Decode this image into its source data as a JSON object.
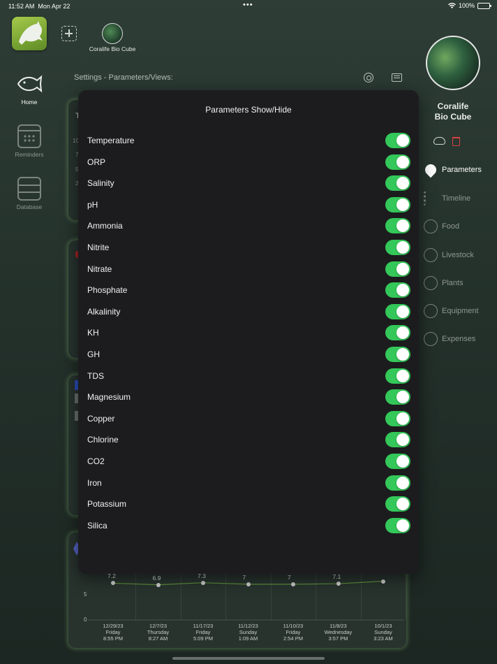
{
  "status_bar": {
    "time": "11:52 AM",
    "date": "Mon Apr 22",
    "dots": "•••",
    "battery": "100%"
  },
  "top_bar": {
    "tank_label": "Coralife Bio Cube"
  },
  "left_nav": {
    "home": "Home",
    "reminders": "Reminders",
    "database": "Database"
  },
  "header": {
    "settings_title": "Settings - Parameters/Views:"
  },
  "right_panel": {
    "tank_name": "Coralife\nBio Cube",
    "nav": [
      {
        "label": "Parameters",
        "icon": "drop-icon"
      },
      {
        "label": "Timeline",
        "icon": "list-icon"
      },
      {
        "label": "Food",
        "icon": "fork-knife-icon"
      },
      {
        "label": "Livestock",
        "icon": "fish-icon"
      },
      {
        "label": "Plants",
        "icon": "plant-icon"
      },
      {
        "label": "Equipment",
        "icon": "gear-icon"
      },
      {
        "label": "Expenses",
        "icon": "card-icon"
      }
    ]
  },
  "background_cards": {
    "snippets": [
      "T",
      "10",
      "7",
      "5",
      "2"
    ]
  },
  "chart_data": {
    "type": "line",
    "categories": [
      "12/29/23",
      "12/7/23",
      "11/17/23",
      "11/12/23",
      "11/10/23",
      "11/8/23",
      "10/1/23"
    ],
    "day_labels": [
      "Friday",
      "Thursday",
      "Friday",
      "Sunday",
      "Friday",
      "Wednesday",
      "Sunday"
    ],
    "time_labels": [
      "8:55 PM",
      "8:27 AM",
      "5:09 PM",
      "1:09 AM",
      "2:54 PM",
      "3:57 PM",
      "3:23 AM"
    ],
    "values": [
      7.2,
      6.9,
      7.3,
      7,
      7,
      7.1,
      7.6
    ],
    "value_labels": [
      "7.2",
      "6.9",
      "7.3",
      "7",
      "7",
      "7.1",
      ""
    ],
    "y_ticks": [
      "5",
      "0"
    ],
    "ylim": [
      0,
      8.5
    ],
    "line_color": "#5d8f3a"
  },
  "modal": {
    "title": "Parameters Show/Hide",
    "parameters": [
      {
        "label": "Temperature",
        "enabled": true
      },
      {
        "label": "ORP",
        "enabled": true
      },
      {
        "label": "Salinity",
        "enabled": true
      },
      {
        "label": "pH",
        "enabled": true
      },
      {
        "label": "Ammonia",
        "enabled": true
      },
      {
        "label": "Nitrite",
        "enabled": true
      },
      {
        "label": "Nitrate",
        "enabled": true
      },
      {
        "label": "Phosphate",
        "enabled": true
      },
      {
        "label": "Alkalinity",
        "enabled": true
      },
      {
        "label": "KH",
        "enabled": true
      },
      {
        "label": "GH",
        "enabled": true
      },
      {
        "label": "TDS",
        "enabled": true
      },
      {
        "label": "Magnesium",
        "enabled": true
      },
      {
        "label": "Copper",
        "enabled": true
      },
      {
        "label": "Chlorine",
        "enabled": true
      },
      {
        "label": "CO2",
        "enabled": true
      },
      {
        "label": "Iron",
        "enabled": true
      },
      {
        "label": "Potassium",
        "enabled": true
      },
      {
        "label": "Silica",
        "enabled": true
      }
    ],
    "toggle_on_color": "#34c759"
  }
}
